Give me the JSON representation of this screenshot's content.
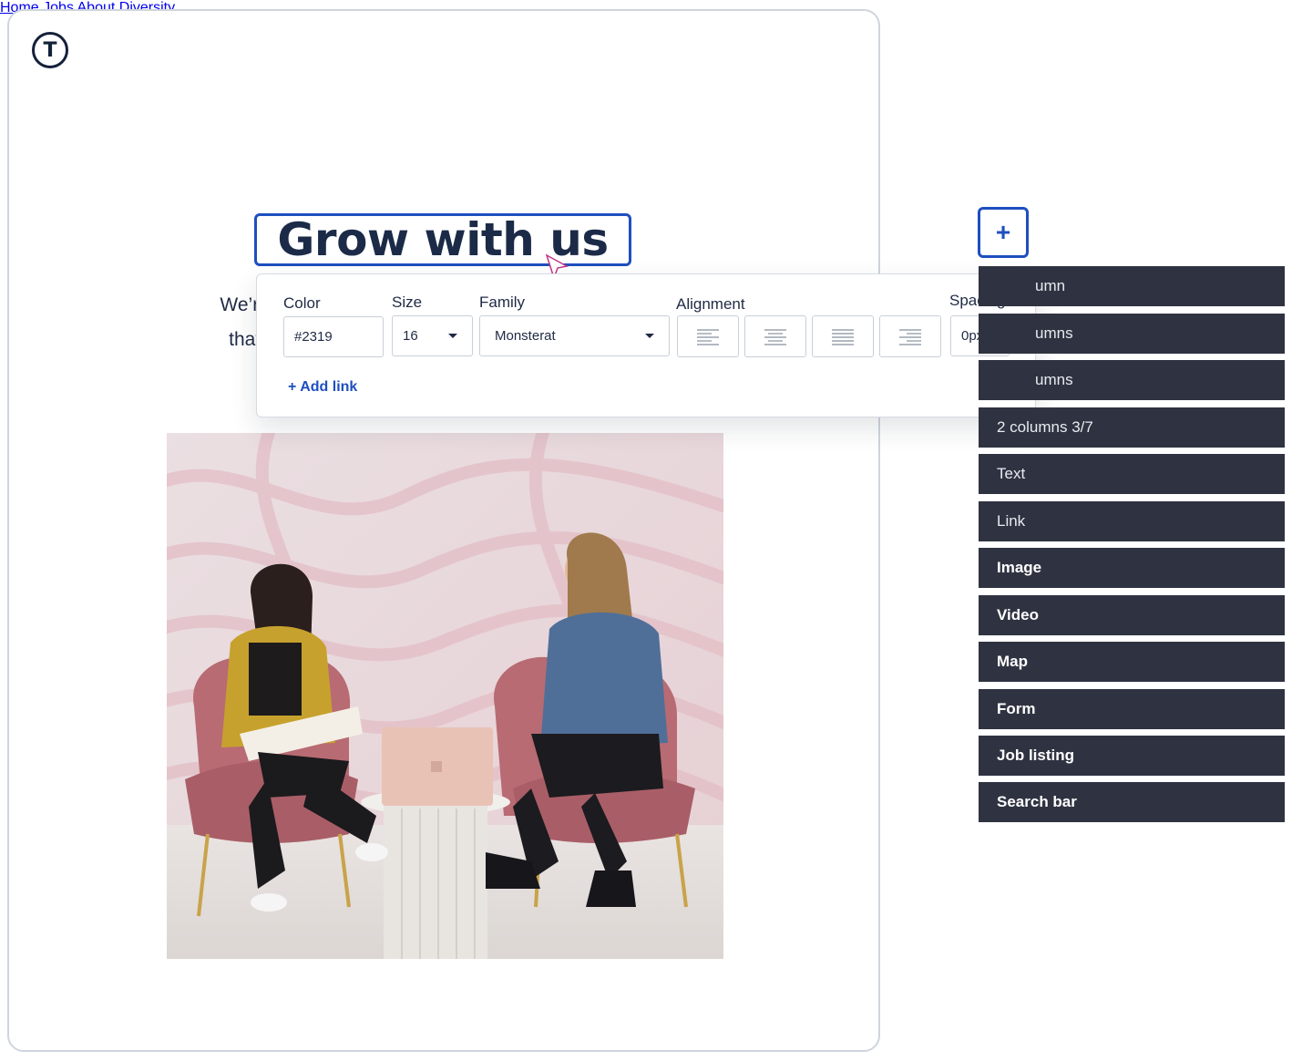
{
  "nav": {
    "logo_letter": "T",
    "items": [
      "Home",
      "Jobs",
      "About",
      "Diversity"
    ]
  },
  "hero": {
    "title": "Grow with us",
    "subtitle_line1": "We’re looking for",
    "subtitle_line2": "that makes a d"
  },
  "text_style_popover": {
    "color_label": "Color",
    "color_value": "#2319",
    "size_label": "Size",
    "size_value": "16",
    "family_label": "Family",
    "family_value": "Monsterat",
    "alignment_label": "Alignment",
    "alignment_options": [
      "align-left-icon",
      "align-center-icon",
      "align-justify-icon",
      "align-right-icon"
    ],
    "spacing_label": "Spacing",
    "spacing_value": "0px",
    "add_link_label": "+ Add link"
  },
  "components_panel": {
    "add_button_symbol": "+",
    "items": [
      "umn",
      "umns",
      "umns",
      "2 columns 3/7",
      "Text",
      "Link",
      "Image",
      "Video",
      "Map",
      "Form",
      "Job listing",
      "Search bar"
    ]
  },
  "colors": {
    "accent": "#1e4fbf",
    "panel_item_bg": "#2f3341",
    "heading": "#1b2a47"
  }
}
